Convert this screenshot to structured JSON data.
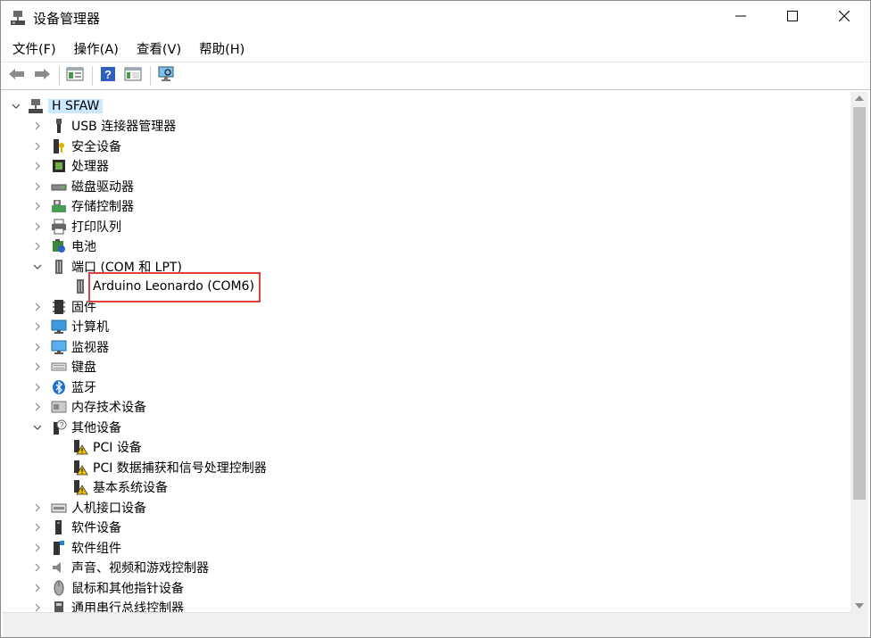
{
  "window": {
    "title": "设备管理器"
  },
  "menu": [
    "文件(F)",
    "操作(A)",
    "查看(V)",
    "帮助(H)"
  ],
  "toolbar": [
    "back-icon",
    "forward-icon",
    "show-hide-tree-icon",
    "help-icon",
    "properties-icon",
    "scan-hardware-icon"
  ],
  "tree": {
    "root": "H        SFAW",
    "categories": [
      {
        "label": "USB 连接器管理器",
        "icon": "usb-icon",
        "expanded": false
      },
      {
        "label": "安全设备",
        "icon": "security-key-icon",
        "expanded": false
      },
      {
        "label": "处理器",
        "icon": "processor-icon",
        "expanded": false
      },
      {
        "label": "磁盘驱动器",
        "icon": "disk-drive-icon",
        "expanded": false
      },
      {
        "label": "存储控制器",
        "icon": "storage-controller-icon",
        "expanded": false
      },
      {
        "label": "打印队列",
        "icon": "printer-icon",
        "expanded": false
      },
      {
        "label": "电池",
        "icon": "battery-icon",
        "expanded": false
      },
      {
        "label": "端口 (COM 和 LPT)",
        "icon": "port-icon",
        "expanded": true,
        "children": [
          {
            "label": "Arduino Leonardo (COM6)",
            "icon": "port-icon",
            "highlighted": true
          }
        ]
      },
      {
        "label": "固件",
        "icon": "firmware-icon",
        "expanded": false
      },
      {
        "label": "计算机",
        "icon": "computer-icon",
        "expanded": false
      },
      {
        "label": "监视器",
        "icon": "monitor-icon",
        "expanded": false
      },
      {
        "label": "键盘",
        "icon": "keyboard-icon",
        "expanded": false
      },
      {
        "label": "蓝牙",
        "icon": "bluetooth-icon",
        "expanded": false
      },
      {
        "label": "内存技术设备",
        "icon": "memory-icon",
        "expanded": false
      },
      {
        "label": "其他设备",
        "icon": "unknown-device-icon",
        "expanded": true,
        "children": [
          {
            "label": "PCI 设备",
            "icon": "warning-device-icon"
          },
          {
            "label": "PCI 数据捕获和信号处理控制器",
            "icon": "warning-device-icon"
          },
          {
            "label": "基本系统设备",
            "icon": "warning-device-icon"
          }
        ]
      },
      {
        "label": "人机接口设备",
        "icon": "hid-icon",
        "expanded": false
      },
      {
        "label": "软件设备",
        "icon": "software-device-icon",
        "expanded": false
      },
      {
        "label": "软件组件",
        "icon": "software-component-icon",
        "expanded": false
      },
      {
        "label": "声音、视频和游戏控制器",
        "icon": "sound-icon",
        "expanded": false
      },
      {
        "label": "鼠标和其他指针设备",
        "icon": "mouse-icon",
        "expanded": false
      },
      {
        "label": "通用串行总线控制器",
        "icon": "usb-controller-icon",
        "expanded": false
      }
    ]
  },
  "colors": {
    "selection": "#cce8ff",
    "highlight_box": "#e04040"
  }
}
